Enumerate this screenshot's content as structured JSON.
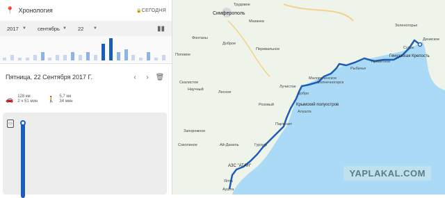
{
  "app": {
    "title": "Хронология",
    "today_label": "СЕГОДНЯ"
  },
  "date_selector": {
    "year": "2017",
    "month": "сентябрь",
    "day": "22"
  },
  "day": {
    "date": "Пятница, 22 Сентября 2017 Г."
  },
  "stats": {
    "drive_distance": "128 км",
    "drive_duration": "2 ч 51 мин",
    "walk_distance": "5,7 км",
    "walk_duration": "34 мин"
  },
  "chart_data": {
    "type": "bar",
    "values": [
      1,
      2,
      1,
      1,
      2,
      3,
      1,
      2,
      2,
      3,
      2,
      3,
      2,
      6,
      8,
      3,
      4,
      2,
      1,
      3,
      1,
      2
    ]
  },
  "map": {
    "labels": {
      "trudovoe": "Трудовое",
      "simferopol": "Симферополь",
      "mazanka": "Мазанка",
      "fontany": "Фонтаны",
      "dobroe": "Доброе",
      "perevalnoe": "Перевальное",
      "zelenogore": "Зеленогорье",
      "denise": "Дениское",
      "sudak": "Судак",
      "genuezskaya": "Генуэзская Крепость",
      "polovoe": "Поповое",
      "skalistoe": "Скалистое",
      "nauchny": "Научный",
      "lesnoe": "Лесное",
      "luchistoe": "Лучистое",
      "dobrostr": "Добро",
      "rybachye": "Рыбачье",
      "malorechenskoe": "Малореченское",
      "solnechnogorsk": "Солнечногорск",
      "privetnoe": "Приветное",
      "krym_polustrovo": "Крымский полуостров",
      "alushta": "Алушта",
      "rozovy": "Розовый",
      "partenit": "Партенит",
      "azs": "АЗС \"АТАН\"",
      "gurzuf": "Гурзуф",
      "ai_danil": "Ай-Даниль",
      "sokolinoe": "Соколиное",
      "yalta": "Ялта",
      "aushta": "Аушта",
      "zaporozhnoe": "Запорожное"
    },
    "watermark": "YAPLAKAL.COM",
    "route_color": "#1c5db9",
    "water_color": "#aadaf5",
    "land_color": "#eef4ea"
  }
}
